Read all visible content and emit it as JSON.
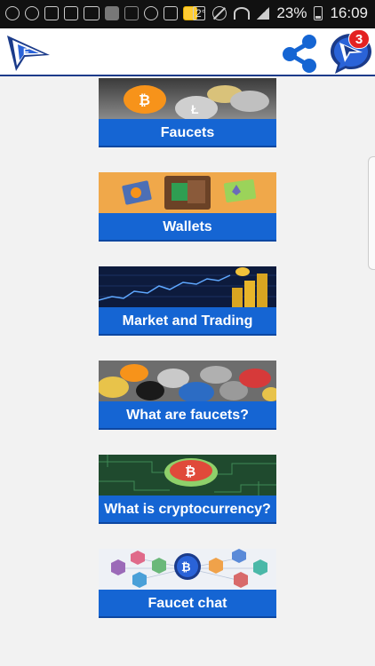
{
  "status_bar": {
    "channel_indicator": "2°",
    "battery_percent": "23%",
    "time": "16:09",
    "icons": [
      "whatsapp-icon",
      "messenger-icon",
      "heart-icon",
      "mail-icon",
      "voicemail-icon",
      "image-icon",
      "list-icon",
      "sync-icon",
      "vpn-icon",
      "gift-icon"
    ]
  },
  "app_bar": {
    "notification_count": "3"
  },
  "menu": [
    {
      "id": "faucets",
      "label": "Faucets"
    },
    {
      "id": "wallets",
      "label": "Wallets"
    },
    {
      "id": "market",
      "label": "Market and Trading"
    },
    {
      "id": "what-faucets",
      "label": "What are faucets?"
    },
    {
      "id": "what-crypto",
      "label": "What is cryptocurrency?"
    },
    {
      "id": "faucet-chat",
      "label": "Faucet chat"
    }
  ],
  "colors": {
    "accent": "#1565d3",
    "brand": "#1b3b8a",
    "badge": "#e32222"
  }
}
